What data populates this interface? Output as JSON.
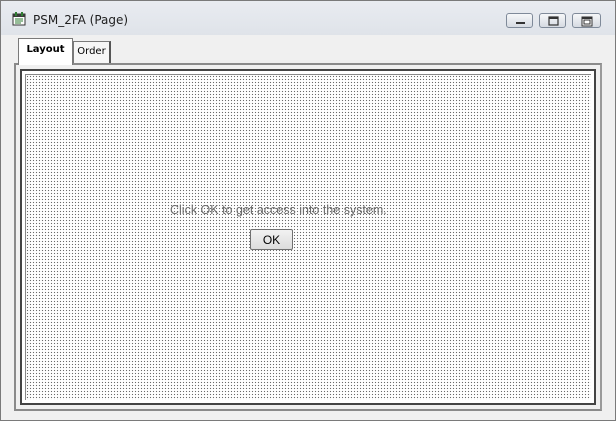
{
  "window": {
    "title": "PSM_2FA (Page)",
    "icon": "page-icon",
    "controls": [
      "minimize-icon",
      "maximize-icon",
      "close-icon"
    ]
  },
  "tabs": [
    {
      "label": "Layout",
      "active": true
    },
    {
      "label": "Order",
      "active": false
    }
  ],
  "content": {
    "message": "Click OK to get access into the system.",
    "ok_label": "OK"
  },
  "colors": {
    "message_text": "#6b6b6b",
    "grid_dots": "#6a6a6a"
  }
}
